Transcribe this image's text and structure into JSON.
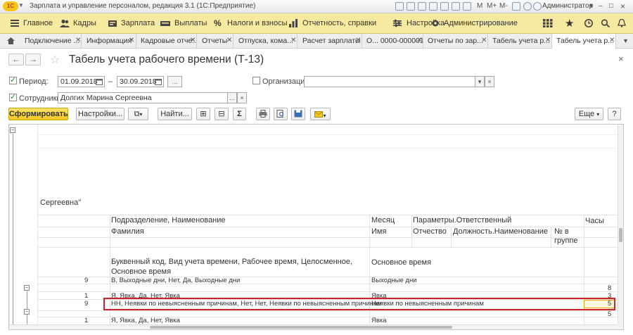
{
  "app": {
    "logo": "1С",
    "title": "Зарплата и управление персоналом, редакция 3.1  (1С:Предприятие)",
    "user": "Администратор",
    "toolbar_m": "M",
    "toolbar_mplus": "M+",
    "toolbar_mminus": "M-"
  },
  "menu": {
    "items": [
      {
        "label": "Главное",
        "icon": "menu-lines-icon"
      },
      {
        "label": "Кадры",
        "icon": "people-icon"
      },
      {
        "label": "Зарплата",
        "icon": "payroll-icon"
      },
      {
        "label": "Выплаты",
        "icon": "payments-icon"
      },
      {
        "label": "Налоги и взносы",
        "icon": "percent-icon"
      },
      {
        "label": "Отчетность, справки",
        "icon": "reports-icon"
      },
      {
        "label": "Настройка",
        "icon": "settings-icon"
      },
      {
        "label": "Администрирование",
        "icon": "admin-gear-icon"
      }
    ]
  },
  "tabs": [
    {
      "label": "Подключение ..."
    },
    {
      "label": "Информация"
    },
    {
      "label": "Кадровые отче..."
    },
    {
      "label": "Отчеты"
    },
    {
      "label": "Отпуска, кома..."
    },
    {
      "label": "Расчет зарплаты"
    },
    {
      "label": "О... 0000-000001"
    },
    {
      "label": "Отчеты по зар..."
    },
    {
      "label": "Табель учета р..."
    },
    {
      "label": "Табель учета р..."
    }
  ],
  "form": {
    "title": "Табель учета рабочего времени (Т-13)",
    "period_label": "Период:",
    "period_from": "01.09.2018",
    "period_dash": "–",
    "period_to": "30.09.2018",
    "ellipsis": "...",
    "org_label": "Организация:",
    "org_value": "",
    "employees_label": "Сотрудники:",
    "employees_value": "Долгих Марина Сергеевна",
    "close_x": "×"
  },
  "buttons": {
    "generate": "Сформировать",
    "settings": "Настройки...",
    "find": "Найти...",
    "sum": "Σ",
    "more": "Еще",
    "help": "?"
  },
  "report": {
    "name_fragment": "Сергеевна\"",
    "hours": "Часы",
    "h_division": "Подразделение, Наименование",
    "h_month": "Месяц",
    "h_params": "Параметры.Ответственный",
    "h_surname": "Фамилия",
    "h_name": "Имя",
    "h_patronymic": "Отчество",
    "h_position": "Должность.Наименование",
    "h_group": "№ в группе",
    "h_letter_code": "Буквенный код, Вид учета времени, Рабочее время, Целосменное, Основное время",
    "h_main_time": "Основное время",
    "rows": [
      {
        "num": "9",
        "desc": "В, Выходные дни, Нет, Да, Выходные дни",
        "main": "Выходные дни",
        "hours": ""
      },
      {
        "num": "",
        "desc": "",
        "main": "",
        "hours": "8"
      },
      {
        "num": "1",
        "desc": "Я, Явка, Да, Нет, Явка",
        "main": "Явка",
        "hours": "3"
      },
      {
        "num": "9",
        "desc": "НН, Неявки по невыясненным причинам, Нет, Нет, Неявки по невыясненным причинам",
        "main": "Неявки по невыясненным причинам",
        "hours": "5"
      },
      {
        "num": "",
        "desc": "",
        "main": "",
        "hours": "5"
      },
      {
        "num": "1",
        "desc": "Я, Явка, Да, Нет, Явка",
        "main": "Явка",
        "hours": ""
      }
    ]
  },
  "colors": {
    "menu_bg": "#f6eaa0",
    "generate_btn": "#f2c81e",
    "highlight_border": "#d0202a"
  }
}
